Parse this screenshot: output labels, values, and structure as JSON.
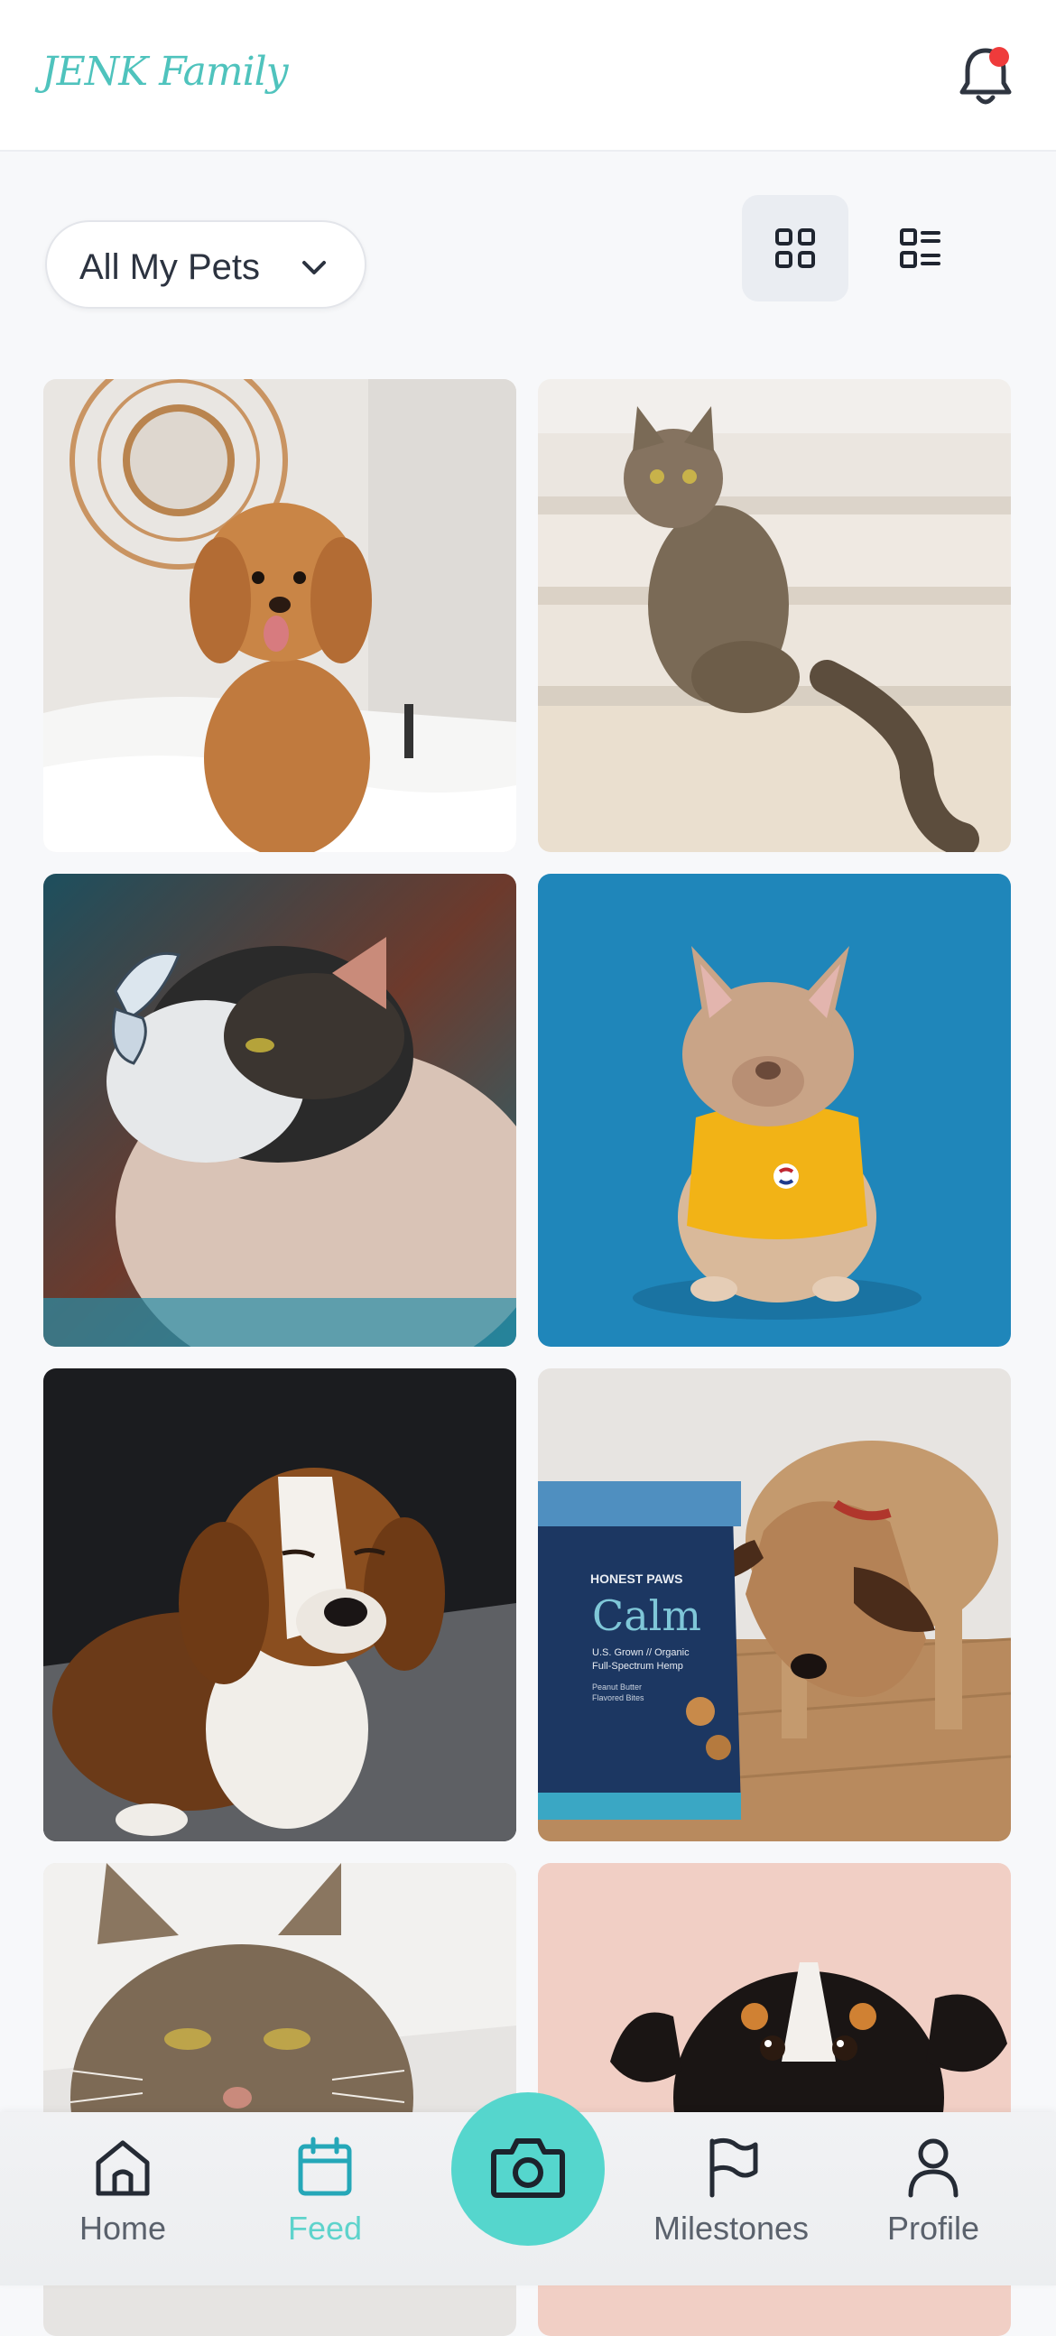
{
  "header": {
    "brand": "JENK Family",
    "notification_dot": true
  },
  "filter": {
    "selected": "All My Pets"
  },
  "view_toggle": {
    "active": "grid"
  },
  "tiles": [
    {
      "subject": "doodle-dog"
    },
    {
      "subject": "tabby-cat-stairs"
    },
    {
      "subject": "cat-with-butterfly"
    },
    {
      "subject": "french-bulldog-yellow-shirt"
    },
    {
      "subject": "beagle"
    },
    {
      "subject": "dog-calm-treats"
    },
    {
      "subject": "tabby-cat-closeup"
    },
    {
      "subject": "terrier-peeking"
    }
  ],
  "treats_bag": {
    "brand": "HONEST PAWS",
    "name": "Calm",
    "line1": "U.S. Grown // Organic",
    "line2": "Full-Spectrum Hemp",
    "line3": "Peanut Butter",
    "line4": "Flavored Bites"
  },
  "nav": {
    "home": "Home",
    "feed": "Feed",
    "milestones": "Milestones",
    "profile": "Profile",
    "active": "Feed"
  },
  "colors": {
    "accent": "#55d6cd",
    "brand": "#4fc3bd",
    "notification": "#ef3b3b"
  }
}
